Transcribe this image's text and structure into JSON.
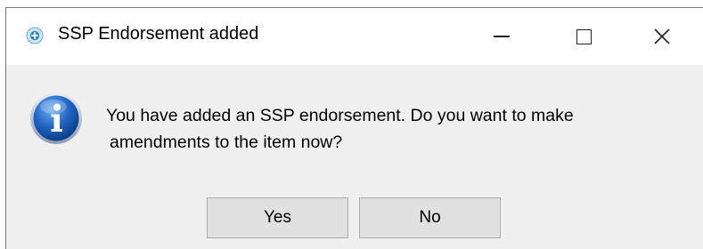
{
  "dialog": {
    "title": "SSP Endorsement added",
    "message_line1": "You have added an SSP endorsement. Do you want to make",
    "message_line2": "amendments to the item now?",
    "icon": "information-icon",
    "app_icon": "app-icon"
  },
  "window_controls": {
    "minimize": "minimize-icon",
    "maximize": "maximize-icon",
    "close": "close-icon"
  },
  "buttons": {
    "yes_label": "Yes",
    "no_label": "No"
  },
  "colors": {
    "dialog_background": "#f0f0f0",
    "titlebar_background": "#ffffff",
    "button_background": "#e1e1e1",
    "button_border": "#adadad",
    "info_icon_blue": "#1e5fb8"
  }
}
